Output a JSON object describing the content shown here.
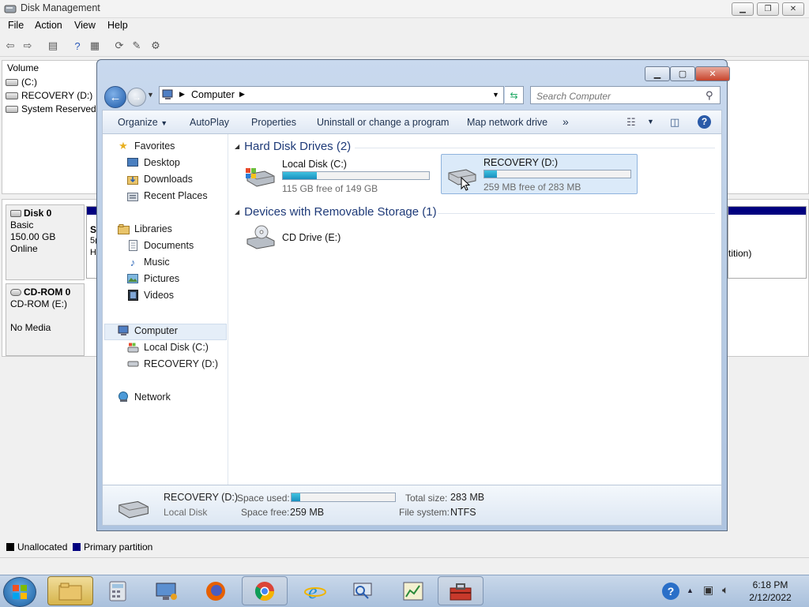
{
  "disk_mgmt": {
    "title": "Disk Management",
    "menus": [
      "File",
      "Action",
      "View",
      "Help"
    ],
    "volume_header": "Volume",
    "volumes": [
      {
        "name": "(C:)",
        "icon": "drive-icon"
      },
      {
        "name": "RECOVERY (D:)",
        "icon": "drive-icon"
      },
      {
        "name": "System Reserved",
        "icon": "drive-icon"
      }
    ],
    "disk0": {
      "name": "Disk 0",
      "type": "Basic",
      "size": "150.00 GB",
      "status": "Online",
      "part_fragment_1": "S",
      "part_fragment_2": "5(",
      "part_fragment_3": "H",
      "part_right_text": "tition)"
    },
    "cdrom0": {
      "name": "CD-ROM 0",
      "drive": "CD-ROM (E:)",
      "media": "No Media"
    },
    "legend": {
      "unallocated": "Unallocated",
      "primary": "Primary partition",
      "unallocated_color": "#000000",
      "primary_color": "#00007f"
    }
  },
  "explorer": {
    "address_location": "Computer",
    "search_placeholder": "Search Computer",
    "commands": {
      "organize": "Organize",
      "autoplay": "AutoPlay",
      "properties": "Properties",
      "uninstall": "Uninstall or change a program",
      "map_drive": "Map network drive",
      "more": "»"
    },
    "nav": {
      "favorites": "Favorites",
      "desktop": "Desktop",
      "downloads": "Downloads",
      "recent_places": "Recent Places",
      "libraries": "Libraries",
      "documents": "Documents",
      "music": "Music",
      "pictures": "Pictures",
      "videos": "Videos",
      "computer": "Computer",
      "local_disk": "Local Disk (C:)",
      "recovery": "RECOVERY (D:)",
      "network": "Network"
    },
    "groups": {
      "hard_disk": "Hard Disk Drives (2)",
      "removable": "Devices with Removable Storage (1)"
    },
    "drives": [
      {
        "name": "Local Disk (C:)",
        "free_text": "115 GB free of 149 GB",
        "used_fraction": 0.23
      },
      {
        "name": "RECOVERY (D:)",
        "free_text": "259 MB free of 283 MB",
        "used_fraction": 0.085
      }
    ],
    "cd_drive": "CD Drive (E:)",
    "details": {
      "name": "RECOVERY (D:)",
      "kind": "Local Disk",
      "space_used_label": "Space used:",
      "space_used_fraction": 0.085,
      "space_free_label": "Space free:",
      "space_free": "259 MB",
      "total_size_label": "Total size:",
      "total_size": "283 MB",
      "fs_label": "File system:",
      "fs": "NTFS"
    }
  },
  "taskbar": {
    "time": "6:18 PM",
    "date": "2/12/2022"
  }
}
